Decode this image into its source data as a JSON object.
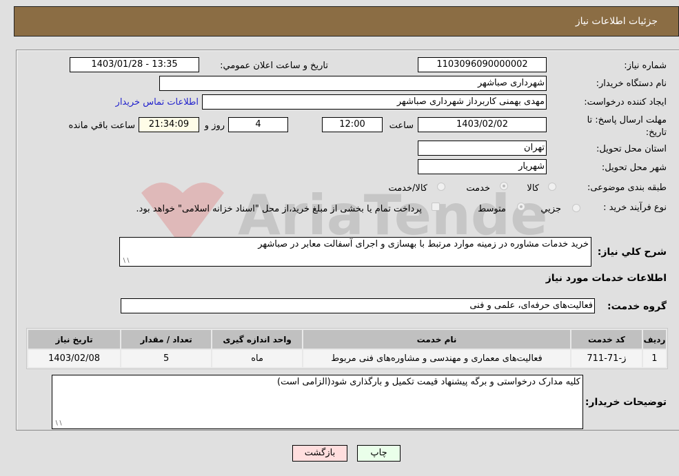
{
  "header": {
    "title": "جزئیات اطلاعات نیاز"
  },
  "form": {
    "need_number": {
      "label": "شماره نیاز:",
      "value": "1103096090000002"
    },
    "announce_datetime": {
      "label": "تاریخ و ساعت اعلان عمومي:",
      "value": "1403/01/28 - 13:35"
    },
    "buyer_org": {
      "label": "نام دستگاه خریدار:",
      "value": "شهرداری صباشهر"
    },
    "requester": {
      "label": "ایجاد کننده درخواست:",
      "value": "مهدی بهمنی کاربرداز شهرداری صباشهر"
    },
    "buyer_contact_link": "اطلاعات تماس خریدار",
    "deadline": {
      "label": "مهلت ارسال پاسخ: تا تاریخ:",
      "date": "1403/02/02",
      "time_label": "ساعت",
      "time": "12:00",
      "days": "4",
      "days_label": "روز و",
      "remaining": "21:34:09",
      "remaining_label": "ساعت باقي مانده"
    },
    "province": {
      "label": "استان محل تحویل:",
      "value": "تهران"
    },
    "city": {
      "label": "شهر محل تحویل:",
      "value": "شهریار"
    },
    "category": {
      "label": "طبقه بندی موضوعی:",
      "options": [
        "کالا",
        "خدمت",
        "کالا/خدمت"
      ],
      "selected": "خدمت"
    },
    "purchase_process": {
      "label": "نوع فرآیند خرید :",
      "options": [
        "جزيي",
        "متوسط"
      ],
      "selected": "متوسط",
      "treasury_note": "پرداخت تمام یا بخشی از مبلغ خرید،از محل \"اسناد خزانه اسلامی\" خواهد بود."
    },
    "general_description": {
      "label": "شرح كلي نياز:",
      "value": "خرید خدمات مشاوره در زمینه موارد مرتبط با بهسازی و اجرای آسفالت معابر در صباشهر"
    },
    "services_section_title": "اطلاعات خدمات مورد نیاز",
    "service_group": {
      "label": "گروه خدمت:",
      "value": "فعالیت‌های حرفه‌ای، علمی و فنی"
    },
    "buyer_notes": {
      "label": "توضیحات خریدار:",
      "value": "کلیه مدارک درخواستی و برگه پیشنهاد قیمت تکمیل و بارگذاری شود(الزامی است)"
    }
  },
  "table": {
    "headers": [
      "ردیف",
      "کد خدمت",
      "نام خدمت",
      "واحد اندازه گیری",
      "تعداد / مقدار",
      "تاریخ نیاز"
    ],
    "rows": [
      [
        "1",
        "ز-71-711",
        "فعالیت‌های معماری و مهندسی و مشاوره‌های فنی مربوط",
        "ماه",
        "5",
        "1403/02/08"
      ]
    ]
  },
  "buttons": {
    "print": "چاپ",
    "back": "بازگشت"
  },
  "colors": {
    "header_bg": "#8b6d44",
    "print_bg": "#eaffea",
    "back_bg": "#ffdede",
    "link": "#2222cc"
  }
}
